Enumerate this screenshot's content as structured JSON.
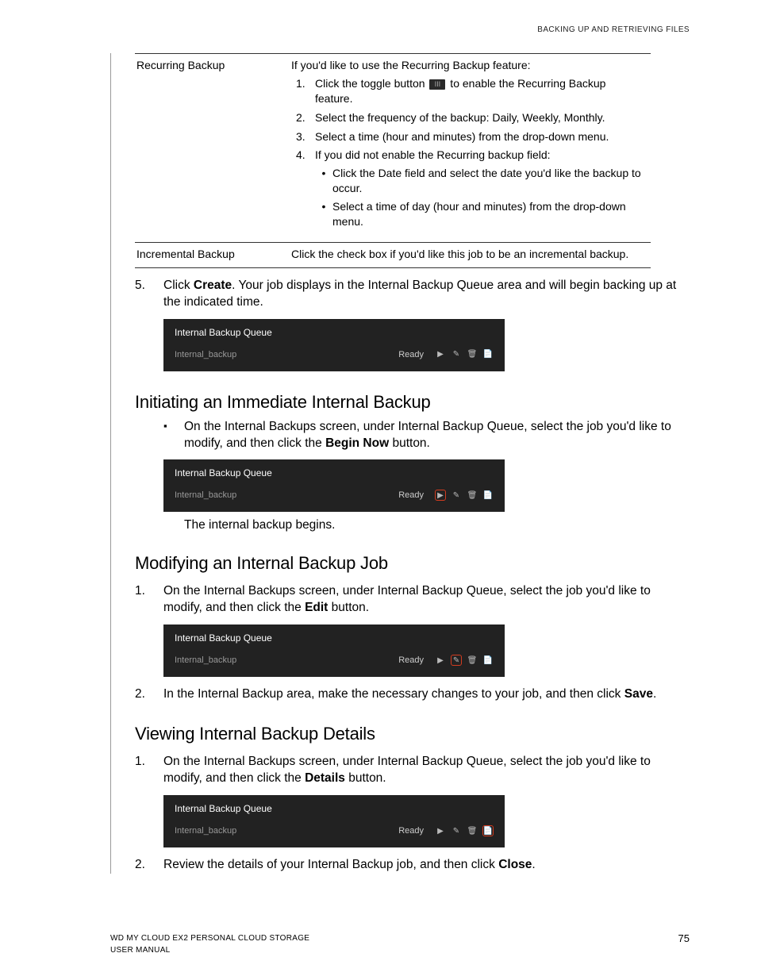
{
  "header": "BACKING UP AND RETRIEVING FILES",
  "table": {
    "rows": [
      {
        "label": "Recurring Backup",
        "intro": "If you'd like to use the Recurring Backup feature:",
        "steps": [
          {
            "n": "1.",
            "pre": "Click the toggle button ",
            "post": " to enable the Recurring Backup feature."
          },
          {
            "n": "2.",
            "text": "Select the frequency of the backup: Daily, Weekly, Monthly."
          },
          {
            "n": "3.",
            "text": "Select a time (hour and minutes) from the drop-down menu."
          },
          {
            "n": "4.",
            "text": "If you did not enable the Recurring backup field:",
            "sub": [
              "Click the Date field and select the date you'd like the backup to occur.",
              "Select a time of day (hour and minutes) from the drop-down menu."
            ]
          }
        ]
      },
      {
        "label": "Incremental Backup",
        "plain": "Click the check box if you'd like this job to be an incremental backup."
      }
    ]
  },
  "step5": {
    "n": "5.",
    "pre": "Click ",
    "bold": "Create",
    "post": ". Your job displays in the Internal Backup Queue area and will begin backing up at the indicated time."
  },
  "queue": {
    "title": "Internal Backup Queue",
    "name": "Internal_backup",
    "status": "Ready"
  },
  "sec1": {
    "heading": "Initiating an Immediate Internal Backup",
    "bullet_pre": "On the Internal Backups screen, under Internal Backup Queue, select the job you'd like to modify, and then click the ",
    "bullet_bold": "Begin Now",
    "bullet_post": " button.",
    "after": "The internal backup begins."
  },
  "sec2": {
    "heading": "Modifying an Internal Backup Job",
    "s1": {
      "n": "1.",
      "pre": "On the Internal Backups screen, under Internal Backup Queue, select the job you'd like to modify, and then click the ",
      "bold": "Edit",
      "post": " button."
    },
    "s2": {
      "n": "2.",
      "pre": "In the Internal Backup area, make the necessary changes to your job, and then click ",
      "bold": "Save",
      "post": "."
    }
  },
  "sec3": {
    "heading": "Viewing Internal Backup Details",
    "s1": {
      "n": "1.",
      "pre": "On the Internal Backups screen, under Internal Backup Queue, select the job you'd like to modify, and then click the ",
      "bold": "Details",
      "post": " button."
    },
    "s2": {
      "n": "2.",
      "pre": "Review the details of your Internal Backup job, and then click ",
      "bold": "Close",
      "post": "."
    }
  },
  "footer": {
    "line1": "WD MY CLOUD EX2 PERSONAL CLOUD STORAGE",
    "line2": "USER MANUAL",
    "page": "75"
  },
  "icons": {
    "toggle": "III"
  }
}
